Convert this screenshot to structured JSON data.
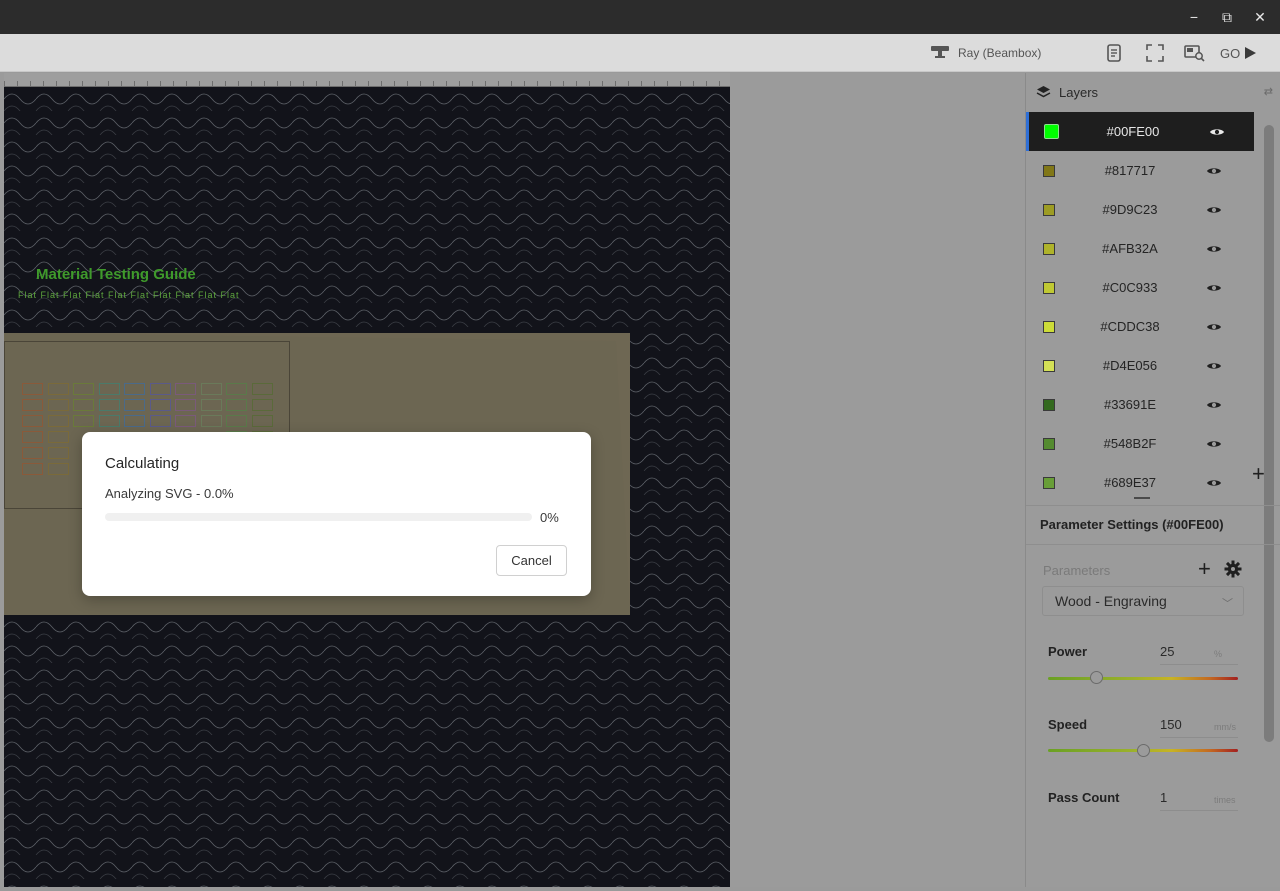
{
  "window": {
    "controls": {
      "minimize": "−",
      "restore": "⧉",
      "close": "✕"
    }
  },
  "toolbar": {
    "device_name": "Ray (Beambox)",
    "go_label": "GO"
  },
  "layers_panel": {
    "title": "Layers",
    "layers": [
      {
        "name": "#00FE00",
        "color": "#00FE00",
        "active": true
      },
      {
        "name": "#817717",
        "color": "#817717",
        "active": false
      },
      {
        "name": "#9D9C23",
        "color": "#9D9C23",
        "active": false
      },
      {
        "name": "#AFB32A",
        "color": "#AFB32A",
        "active": false
      },
      {
        "name": "#C0C933",
        "color": "#C0C933",
        "active": false
      },
      {
        "name": "#CDDC38",
        "color": "#CDDC38",
        "active": false
      },
      {
        "name": "#D4E056",
        "color": "#D4E056",
        "active": false
      },
      {
        "name": "#33691E",
        "color": "#33691E",
        "active": false
      },
      {
        "name": "#548B2F",
        "color": "#548B2F",
        "active": false
      },
      {
        "name": "#689E37",
        "color": "#689E37",
        "active": false
      }
    ],
    "add_icon": "+"
  },
  "parameters": {
    "title": "Parameter Settings (#00FE00)",
    "section_label": "Parameters",
    "preset": "Wood - Engraving",
    "power": {
      "label": "Power",
      "value": "25",
      "unit": "%",
      "fraction": 0.25
    },
    "speed": {
      "label": "Speed",
      "value": "150",
      "unit": "mm/s",
      "fraction": 0.5
    },
    "pass_count": {
      "label": "Pass Count",
      "value": "1",
      "unit": "times"
    }
  },
  "board": {
    "title": "Material Testing Guide",
    "header_row": "Flat Flat Flat Flat Flat Flat Flat Flat Flat Flat"
  },
  "modal": {
    "title": "Calculating",
    "status": "Analyzing SVG - 0.0%",
    "progress": 0,
    "progress_label": "0%",
    "cancel_label": "Cancel"
  }
}
